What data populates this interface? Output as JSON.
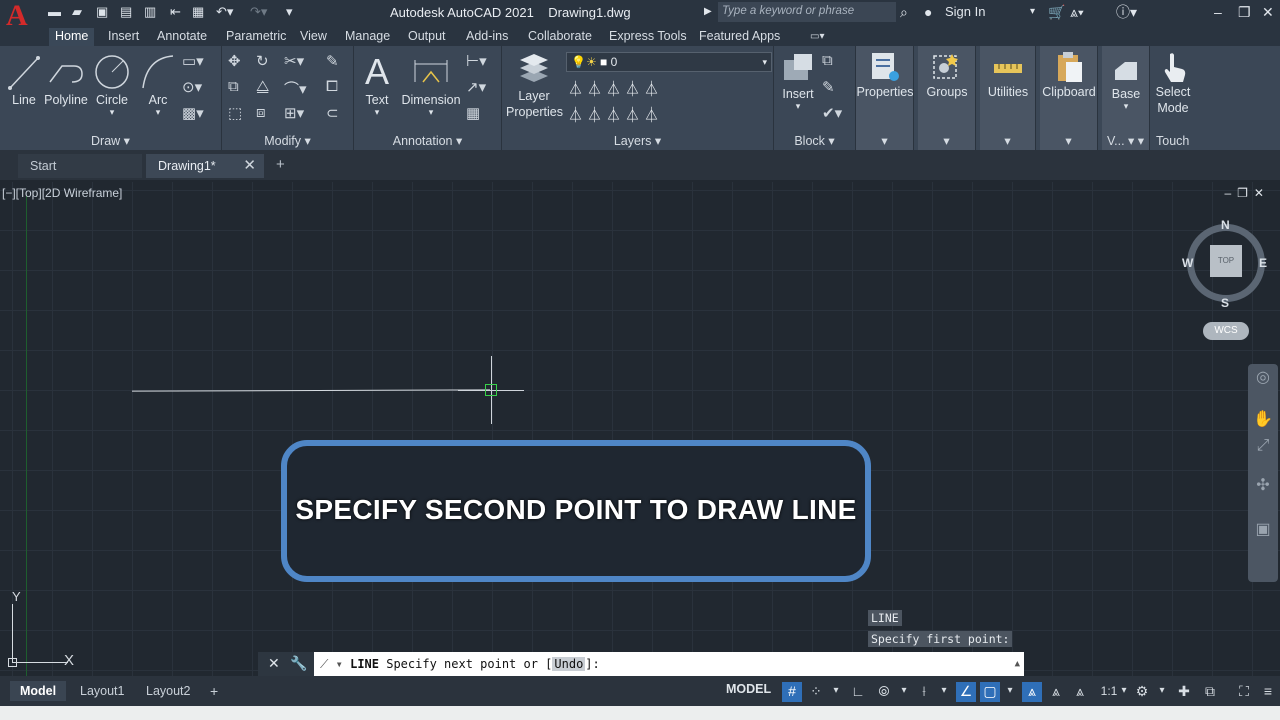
{
  "app": {
    "title": "Autodesk AutoCAD 2021    Drawing1.dwg",
    "logo_letter": "A",
    "search_placeholder": "Type a keyword or phrase",
    "sign_in": "Sign In"
  },
  "ribbon_tabs": [
    "Home",
    "Insert",
    "Annotate",
    "Parametric",
    "View",
    "Manage",
    "Output",
    "Add-ins",
    "Collaborate",
    "Express Tools",
    "Featured Apps"
  ],
  "ribbon": {
    "draw": {
      "label": "Draw",
      "line": "Line",
      "polyline": "Polyline",
      "circle": "Circle",
      "arc": "Arc"
    },
    "modify": {
      "label": "Modify"
    },
    "annotation": {
      "label": "Annotation",
      "text": "Text",
      "dimension": "Dimension"
    },
    "layers": {
      "label": "Layers",
      "layer_properties_1": "Layer",
      "layer_properties_2": "Properties",
      "current_layer": "0"
    },
    "block": {
      "label": "Block",
      "insert": "Insert"
    },
    "properties": "Properties",
    "groups": "Groups",
    "utilities": "Utilities",
    "clipboard": "Clipboard",
    "base": "Base",
    "view_short": "V...",
    "select_mode_1": "Select",
    "select_mode_2": "Mode",
    "touch": "Touch"
  },
  "file_tabs": {
    "start": "Start",
    "drawing": "Drawing1*"
  },
  "viewport": {
    "label": "[−][Top][2D Wireframe]",
    "viewcube": {
      "face": "TOP",
      "n": "N",
      "s": "S",
      "e": "E",
      "w": "W",
      "wcs": "WCS"
    },
    "ucs_x": "X",
    "ucs_y": "Y"
  },
  "banner_text": "SPECIFY SECOND POINT TO DRAW LINE",
  "command_history": [
    "LINE",
    "Specify first point:"
  ],
  "command_line": {
    "command": "LINE",
    "prompt": " Specify next point or [",
    "option": "Undo",
    "suffix": "]:"
  },
  "layout_tabs": {
    "model": "Model",
    "layout1": "Layout1",
    "layout2": "Layout2"
  },
  "status": {
    "model_space": "MODEL",
    "scale": "1:1"
  },
  "colors": {
    "accent_blue": "#4f86c6",
    "logo_red": "#d42a2a",
    "pick_green": "#39d24a"
  }
}
